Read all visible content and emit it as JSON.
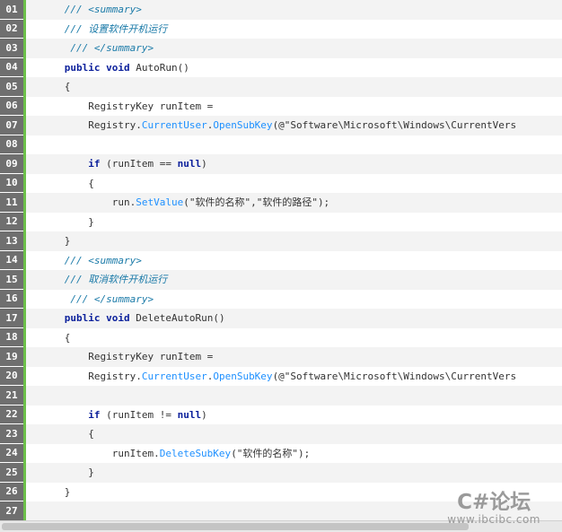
{
  "lines": [
    {
      "n": "01",
      "indent": "      ",
      "tokens": [
        {
          "t": "cm",
          "v": "/// <summary>"
        }
      ]
    },
    {
      "n": "02",
      "indent": "      ",
      "tokens": [
        {
          "t": "cm",
          "v": "/// 设置软件开机运行"
        }
      ]
    },
    {
      "n": "03",
      "indent": "       ",
      "tokens": [
        {
          "t": "cm",
          "v": "/// </summary>"
        }
      ]
    },
    {
      "n": "04",
      "indent": "      ",
      "tokens": [
        {
          "t": "kw",
          "v": "public"
        },
        {
          "t": "p",
          "v": " "
        },
        {
          "t": "kw",
          "v": "void"
        },
        {
          "t": "p",
          "v": " AutoRun()"
        }
      ]
    },
    {
      "n": "05",
      "indent": "      ",
      "tokens": [
        {
          "t": "p",
          "v": "{"
        }
      ]
    },
    {
      "n": "06",
      "indent": "          ",
      "tokens": [
        {
          "t": "p",
          "v": "RegistryKey runItem ="
        }
      ]
    },
    {
      "n": "07",
      "indent": "          ",
      "tokens": [
        {
          "t": "p",
          "v": "Registry."
        },
        {
          "t": "mt",
          "v": "CurrentUser"
        },
        {
          "t": "p",
          "v": "."
        },
        {
          "t": "mt",
          "v": "OpenSubKey"
        },
        {
          "t": "p",
          "v": "(@\"Software\\Microsoft\\Windows\\CurrentVers"
        }
      ]
    },
    {
      "n": "08",
      "indent": "",
      "tokens": []
    },
    {
      "n": "09",
      "indent": "          ",
      "tokens": [
        {
          "t": "kw",
          "v": "if"
        },
        {
          "t": "p",
          "v": " (runItem == "
        },
        {
          "t": "kw",
          "v": "null"
        },
        {
          "t": "p",
          "v": ")"
        }
      ]
    },
    {
      "n": "10",
      "indent": "          ",
      "tokens": [
        {
          "t": "p",
          "v": "{"
        }
      ]
    },
    {
      "n": "11",
      "indent": "              ",
      "tokens": [
        {
          "t": "p",
          "v": "run."
        },
        {
          "t": "mt",
          "v": "SetValue"
        },
        {
          "t": "p",
          "v": "(\"软件的名称\",\"软件的路径\");"
        }
      ]
    },
    {
      "n": "12",
      "indent": "          ",
      "tokens": [
        {
          "t": "p",
          "v": "}"
        }
      ]
    },
    {
      "n": "13",
      "indent": "      ",
      "tokens": [
        {
          "t": "p",
          "v": "}"
        }
      ]
    },
    {
      "n": "14",
      "indent": "      ",
      "tokens": [
        {
          "t": "cm",
          "v": "/// <summary>"
        }
      ]
    },
    {
      "n": "15",
      "indent": "      ",
      "tokens": [
        {
          "t": "cm",
          "v": "/// 取消软件开机运行"
        }
      ]
    },
    {
      "n": "16",
      "indent": "       ",
      "tokens": [
        {
          "t": "cm",
          "v": "/// </summary>"
        }
      ]
    },
    {
      "n": "17",
      "indent": "      ",
      "tokens": [
        {
          "t": "kw",
          "v": "public"
        },
        {
          "t": "p",
          "v": " "
        },
        {
          "t": "kw",
          "v": "void"
        },
        {
          "t": "p",
          "v": " DeleteAutoRun()"
        }
      ]
    },
    {
      "n": "18",
      "indent": "      ",
      "tokens": [
        {
          "t": "p",
          "v": "{"
        }
      ]
    },
    {
      "n": "19",
      "indent": "          ",
      "tokens": [
        {
          "t": "p",
          "v": "RegistryKey runItem ="
        }
      ]
    },
    {
      "n": "20",
      "indent": "          ",
      "tokens": [
        {
          "t": "p",
          "v": "Registry."
        },
        {
          "t": "mt",
          "v": "CurrentUser"
        },
        {
          "t": "p",
          "v": "."
        },
        {
          "t": "mt",
          "v": "OpenSubKey"
        },
        {
          "t": "p",
          "v": "(@\"Software\\Microsoft\\Windows\\CurrentVers"
        }
      ]
    },
    {
      "n": "21",
      "indent": "",
      "tokens": []
    },
    {
      "n": "22",
      "indent": "          ",
      "tokens": [
        {
          "t": "kw",
          "v": "if"
        },
        {
          "t": "p",
          "v": " (runItem != "
        },
        {
          "t": "kw",
          "v": "null"
        },
        {
          "t": "p",
          "v": ")"
        }
      ]
    },
    {
      "n": "23",
      "indent": "          ",
      "tokens": [
        {
          "t": "p",
          "v": "{"
        }
      ]
    },
    {
      "n": "24",
      "indent": "              ",
      "tokens": [
        {
          "t": "p",
          "v": "runItem."
        },
        {
          "t": "mt",
          "v": "DeleteSubKey"
        },
        {
          "t": "p",
          "v": "(\"软件的名称\");"
        }
      ]
    },
    {
      "n": "25",
      "indent": "          ",
      "tokens": [
        {
          "t": "p",
          "v": "}"
        }
      ]
    },
    {
      "n": "26",
      "indent": "      ",
      "tokens": [
        {
          "t": "p",
          "v": "}"
        }
      ]
    },
    {
      "n": "27",
      "indent": "",
      "tokens": []
    }
  ],
  "watermark": {
    "title": "C#论坛",
    "url": "www.ibcibc.com"
  }
}
